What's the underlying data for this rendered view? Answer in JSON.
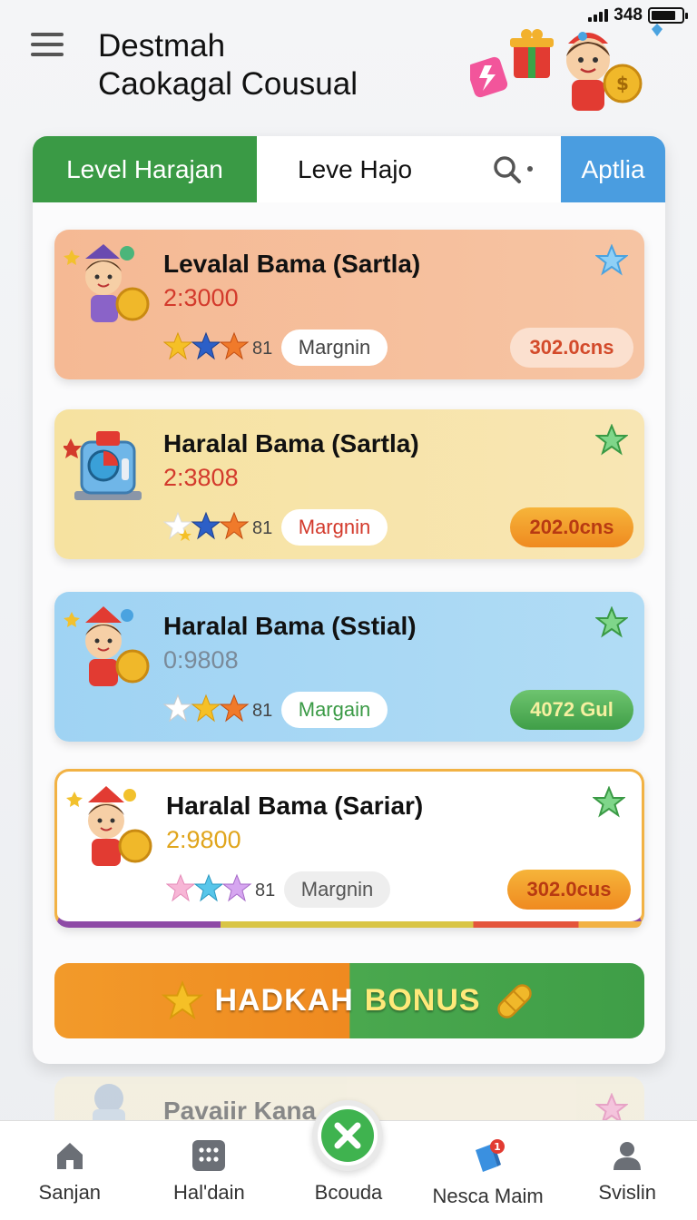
{
  "status": {
    "battery_text": "348"
  },
  "header": {
    "title_line1": "Destmah",
    "title_line2": "Caokagal Cousual"
  },
  "tabs": [
    {
      "label": "Level Harajan"
    },
    {
      "label": "Leve Hajo"
    },
    {
      "label": "Aptlia"
    }
  ],
  "cards": [
    {
      "title": "Levalal Bama (Sartla)",
      "score": "2:3000",
      "score_color": "#d33a2c",
      "count": "81",
      "chip": "Margnin",
      "chip_color": "#444444",
      "price": "302.0cns"
    },
    {
      "title": "Haralal Bama (Sartla)",
      "score": "2:3808",
      "score_color": "#d33a2c",
      "count": "81",
      "chip": "Margnin",
      "chip_color": "#d33a2c",
      "price": "202.0cns"
    },
    {
      "title": "Haralal Bama (Sstial)",
      "score": "0:9808",
      "score_color": "#7a8a99",
      "count": "81",
      "chip": "Margain",
      "chip_color": "#3a9a45",
      "price": "4072 Gul"
    },
    {
      "title": "Haralal Bama (Sariar)",
      "score": "2:9800",
      "score_color": "#e0a51c",
      "count": "81",
      "chip": "Margnin",
      "chip_color": "#555555",
      "price": "302.0cus"
    }
  ],
  "bonus": {
    "part1": "HADKAH",
    "part2": "BONUS"
  },
  "peek": {
    "title": "Pavaiir Kana"
  },
  "nav": [
    {
      "label": "Sanjan",
      "icon": "home-icon"
    },
    {
      "label": "Hal'dain",
      "icon": "grid-icon"
    },
    {
      "label": "Bcouda",
      "icon": "close-icon"
    },
    {
      "label": "Nesca Maim",
      "icon": "cube-icon",
      "badge": "1"
    },
    {
      "label": "Svislin",
      "icon": "user-icon"
    }
  ]
}
